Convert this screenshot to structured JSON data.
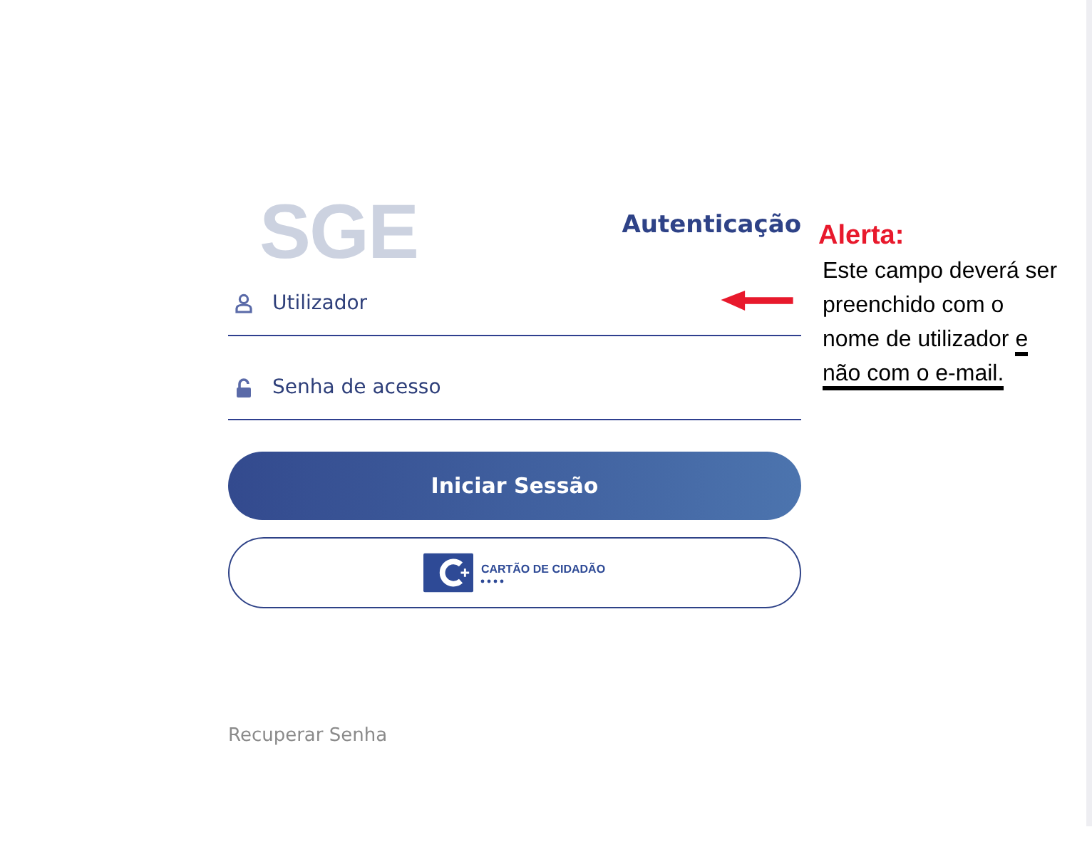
{
  "logo": "SGE",
  "heading": "Autenticação",
  "fields": [
    {
      "kind": "user",
      "placeholder": "Utilizador"
    },
    {
      "kind": "lock",
      "placeholder": "Senha de acesso"
    }
  ],
  "login_button": "Iniciar Sessão",
  "citizen_card_button": {
    "label": "CARTÃO DE CIDADÃO"
  },
  "recover_link": "Recuperar Senha",
  "alert": {
    "title": "Alerta:",
    "lines": [
      [
        {
          "text": "Este campo deverá ser",
          "underlined": false
        }
      ],
      [
        {
          "text": "preenchido com o",
          "underlined": false
        }
      ],
      [
        {
          "text": "nome de utilizador ",
          "underlined": false
        },
        {
          "text": "e",
          "underlined": true
        }
      ],
      [
        {
          "text": "não com o e-mail.",
          "underlined": true
        }
      ]
    ]
  }
}
